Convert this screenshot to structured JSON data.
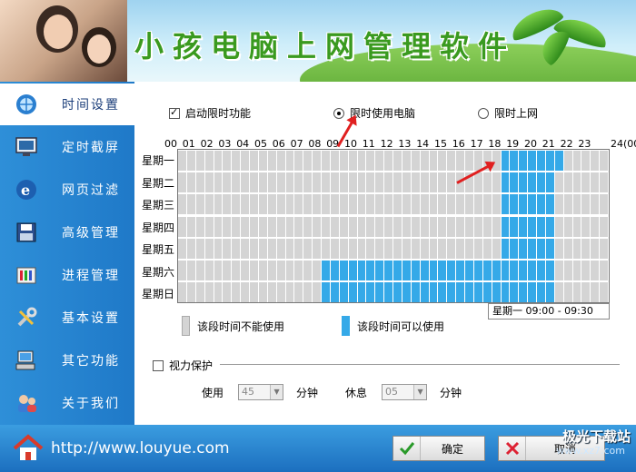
{
  "banner": {
    "title": "小孩电脑上网管理软件"
  },
  "sidebar": {
    "items": [
      {
        "label": "时间设置",
        "icon": "clock-globe-icon",
        "active": true
      },
      {
        "label": "定时截屏",
        "icon": "monitor-icon",
        "active": false
      },
      {
        "label": "网页过滤",
        "icon": "ie-icon",
        "active": false
      },
      {
        "label": "高级管理",
        "icon": "save-disk-icon",
        "active": false
      },
      {
        "label": "进程管理",
        "icon": "tools-icon",
        "active": false
      },
      {
        "label": "基本设置",
        "icon": "wrench-icon",
        "active": false
      },
      {
        "label": "其它功能",
        "icon": "computer-icon",
        "active": false
      },
      {
        "label": "关于我们",
        "icon": "people-icon",
        "active": false
      }
    ]
  },
  "time_settings": {
    "enable_label": "启动限时功能",
    "enable_checked": true,
    "mode_options": [
      {
        "label": "限时使用电脑",
        "selected": true
      },
      {
        "label": "限时上网",
        "selected": false
      }
    ],
    "hours": [
      "00",
      "01",
      "02",
      "03",
      "04",
      "05",
      "06",
      "07",
      "08",
      "09",
      "10",
      "11",
      "12",
      "13",
      "14",
      "15",
      "16",
      "17",
      "18",
      "19",
      "20",
      "21",
      "22",
      "23"
    ],
    "hour_end": "24(00)",
    "days": [
      "星期一",
      "星期二",
      "星期三",
      "星期四",
      "星期五",
      "星期六",
      "星期日"
    ],
    "schedule": [
      {
        "on_from_slot": 36,
        "on_to_slot": 43
      },
      {
        "on_from_slot": 36,
        "on_to_slot": 42
      },
      {
        "on_from_slot": 36,
        "on_to_slot": 42
      },
      {
        "on_from_slot": 36,
        "on_to_slot": 42
      },
      {
        "on_from_slot": 36,
        "on_to_slot": 42
      },
      {
        "on_from_slot": 16,
        "on_to_slot": 42
      },
      {
        "on_from_slot": 16,
        "on_to_slot": 42
      }
    ],
    "status_text": "星期一   09:00 - 09:30",
    "legend_off": "该段时间不能使用",
    "legend_on": "该段时间可以使用",
    "colors": {
      "off": "#d4d4d4",
      "on": "#35a9e8"
    }
  },
  "eye_protection": {
    "label": "视力保护",
    "checked": false,
    "use_label": "使用",
    "use_value": "45",
    "minute1": "分钟",
    "rest_label": "休息",
    "rest_value": "05",
    "minute2": "分钟"
  },
  "footer": {
    "url": "http://www.louyue.com",
    "ok_label": "确定",
    "cancel_label": "取消",
    "watermark": "极光下载站",
    "watermark_sub": "www.xz7.com"
  }
}
